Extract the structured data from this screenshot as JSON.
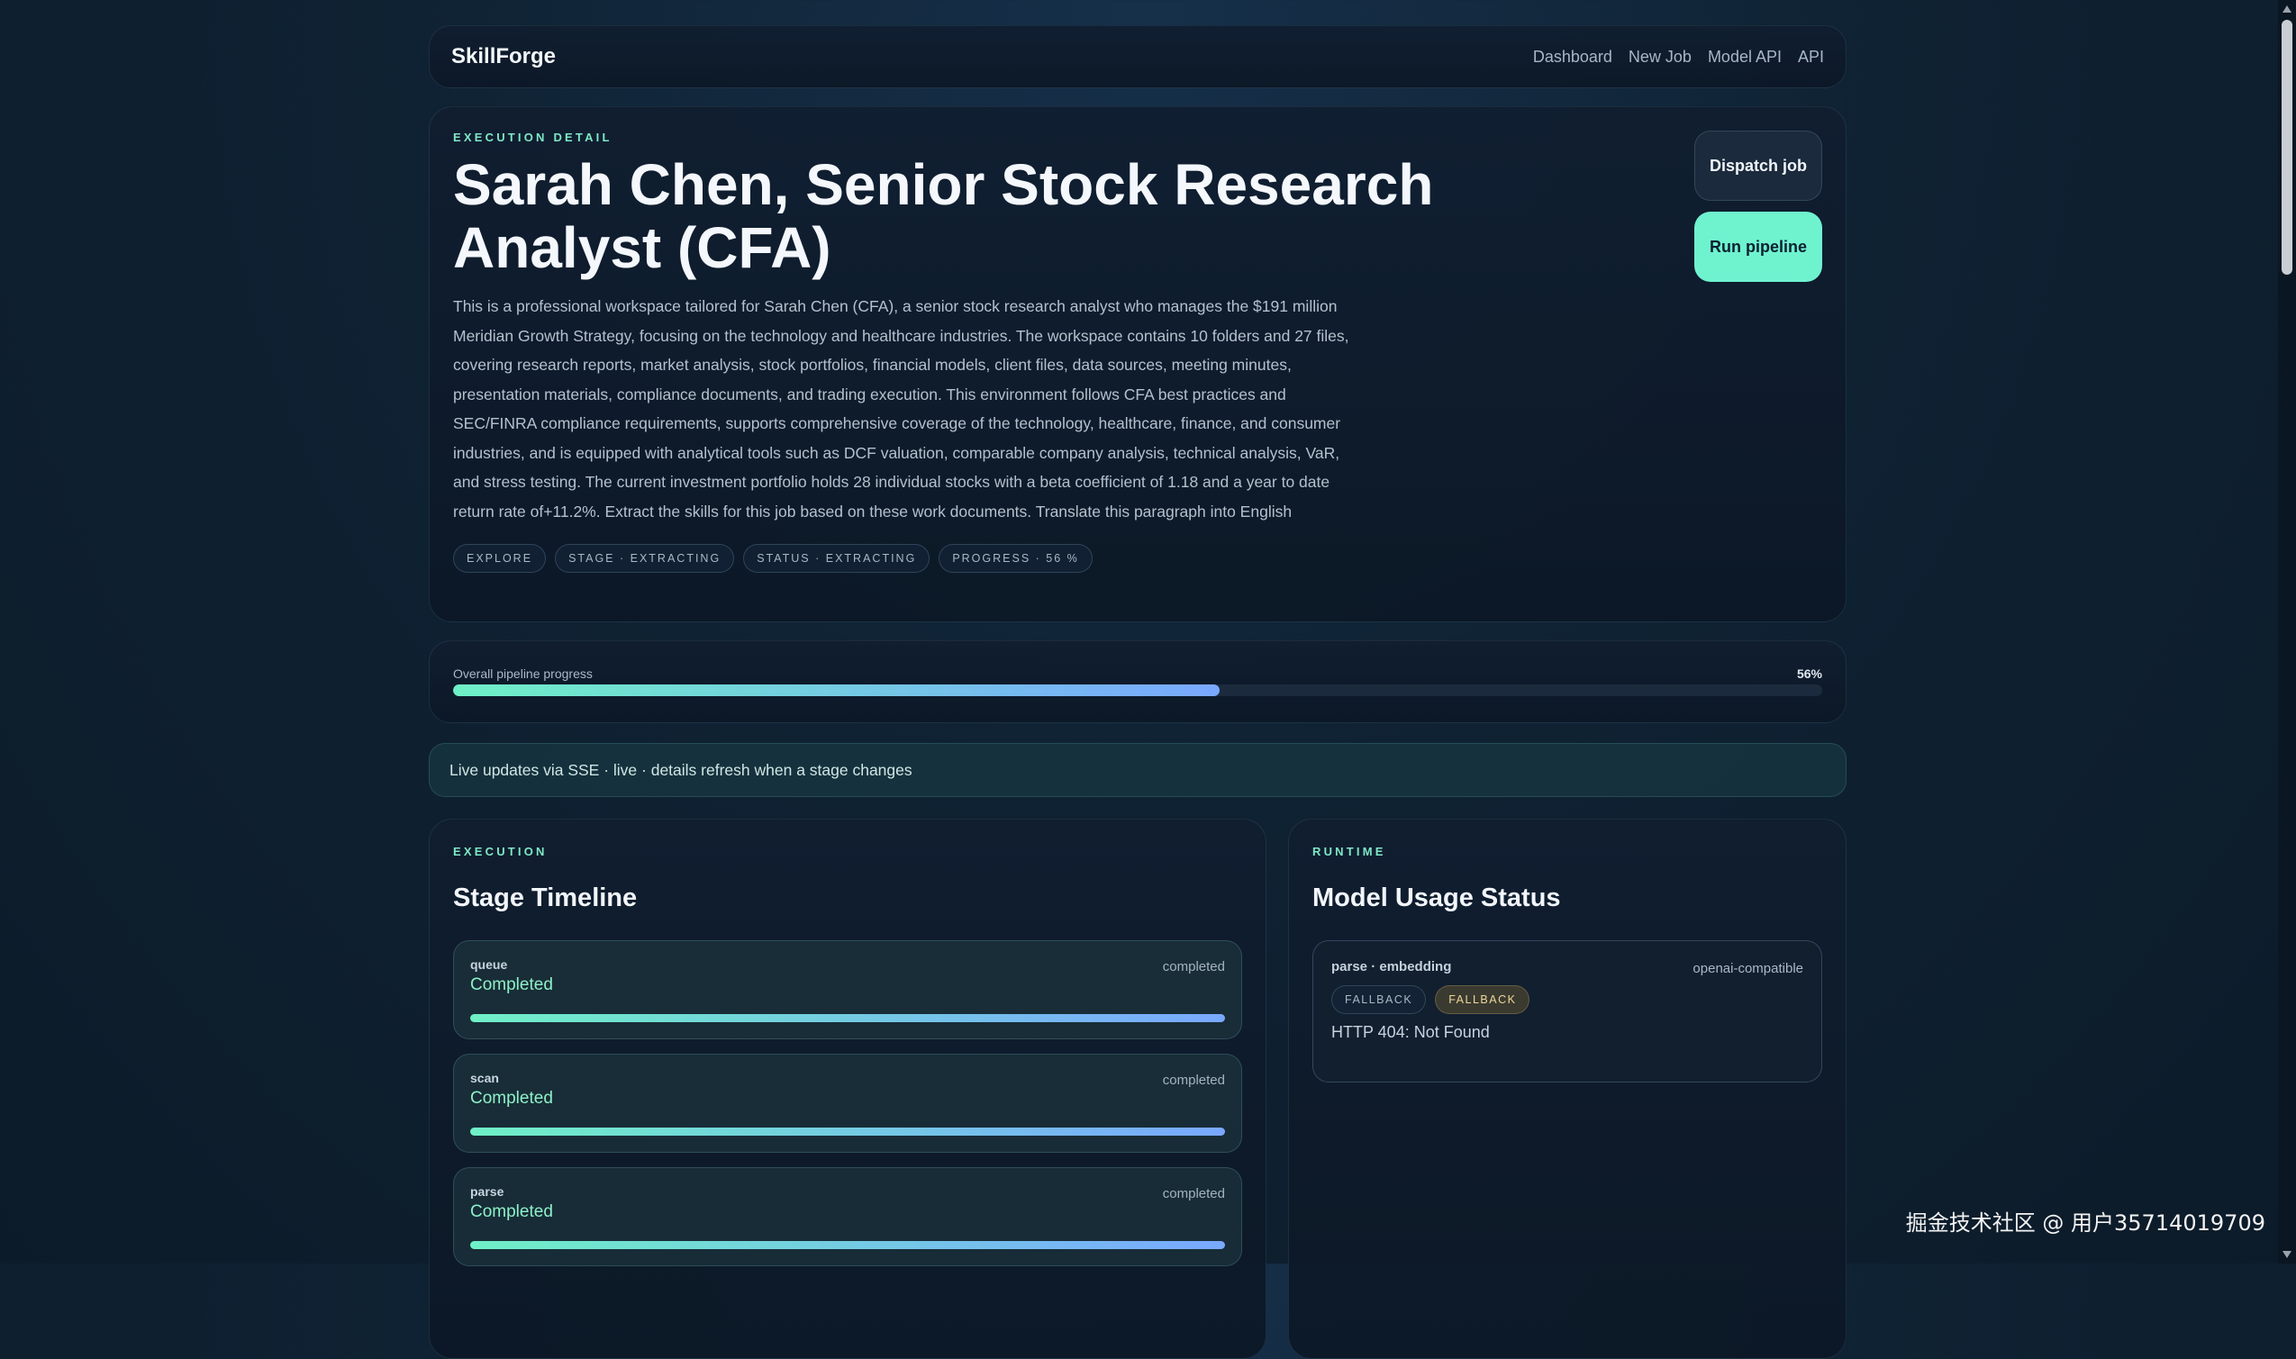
{
  "nav": {
    "brand": "SkillForge",
    "links": [
      "Dashboard",
      "New Job",
      "Model API",
      "API"
    ]
  },
  "hero": {
    "eyebrow": "EXECUTION DETAIL",
    "title": "Sarah Chen, Senior Stock Research Analyst (CFA)",
    "description": "This is a professional workspace tailored for Sarah Chen (CFA), a senior stock research analyst who manages the $191 million Meridian Growth Strategy, focusing on the technology and healthcare industries. The workspace contains 10 folders and 27 files, covering research reports, market analysis, stock portfolios, financial models, client files, data sources, meeting minutes, presentation materials, compliance documents, and trading execution. This environment follows CFA best practices and SEC/FINRA compliance requirements, supports comprehensive coverage of the technology, healthcare, finance, and consumer industries, and is equipped with analytical tools such as DCF valuation, comparable company analysis, technical analysis, VaR, and stress testing. The current investment portfolio holds 28 individual stocks with a beta coefficient of 1.18 and a year to date return rate of+11.2%. Extract the skills for this job based on these work documents. Translate this paragraph into English",
    "chips": [
      "EXPLORE",
      "STAGE · EXTRACTING",
      "STATUS · EXTRACTING",
      "PROGRESS · 56 %"
    ],
    "dispatch_label": "Dispatch job",
    "run_label": "Run pipeline"
  },
  "progress": {
    "label": "Overall pipeline progress",
    "value_text": "56%",
    "value": 0.56
  },
  "sse": {
    "text": "Live updates via SSE · live · details refresh when a stage changes"
  },
  "execution": {
    "eyebrow": "EXECUTION",
    "title": "Stage Timeline",
    "stages": [
      {
        "name": "queue",
        "state": "Completed",
        "status": "completed"
      },
      {
        "name": "scan",
        "state": "Completed",
        "status": "completed"
      },
      {
        "name": "parse",
        "state": "Completed",
        "status": "completed"
      }
    ]
  },
  "runtime": {
    "eyebrow": "RUNTIME",
    "title": "Model Usage Status",
    "usage": {
      "name": "parse · embedding",
      "provider": "openai-compatible",
      "badges": [
        "FALLBACK",
        "FALLBACK"
      ],
      "error": "HTTP 404: Not Found"
    }
  },
  "watermark": "掘金技术社区 @ 用户35714019709"
}
